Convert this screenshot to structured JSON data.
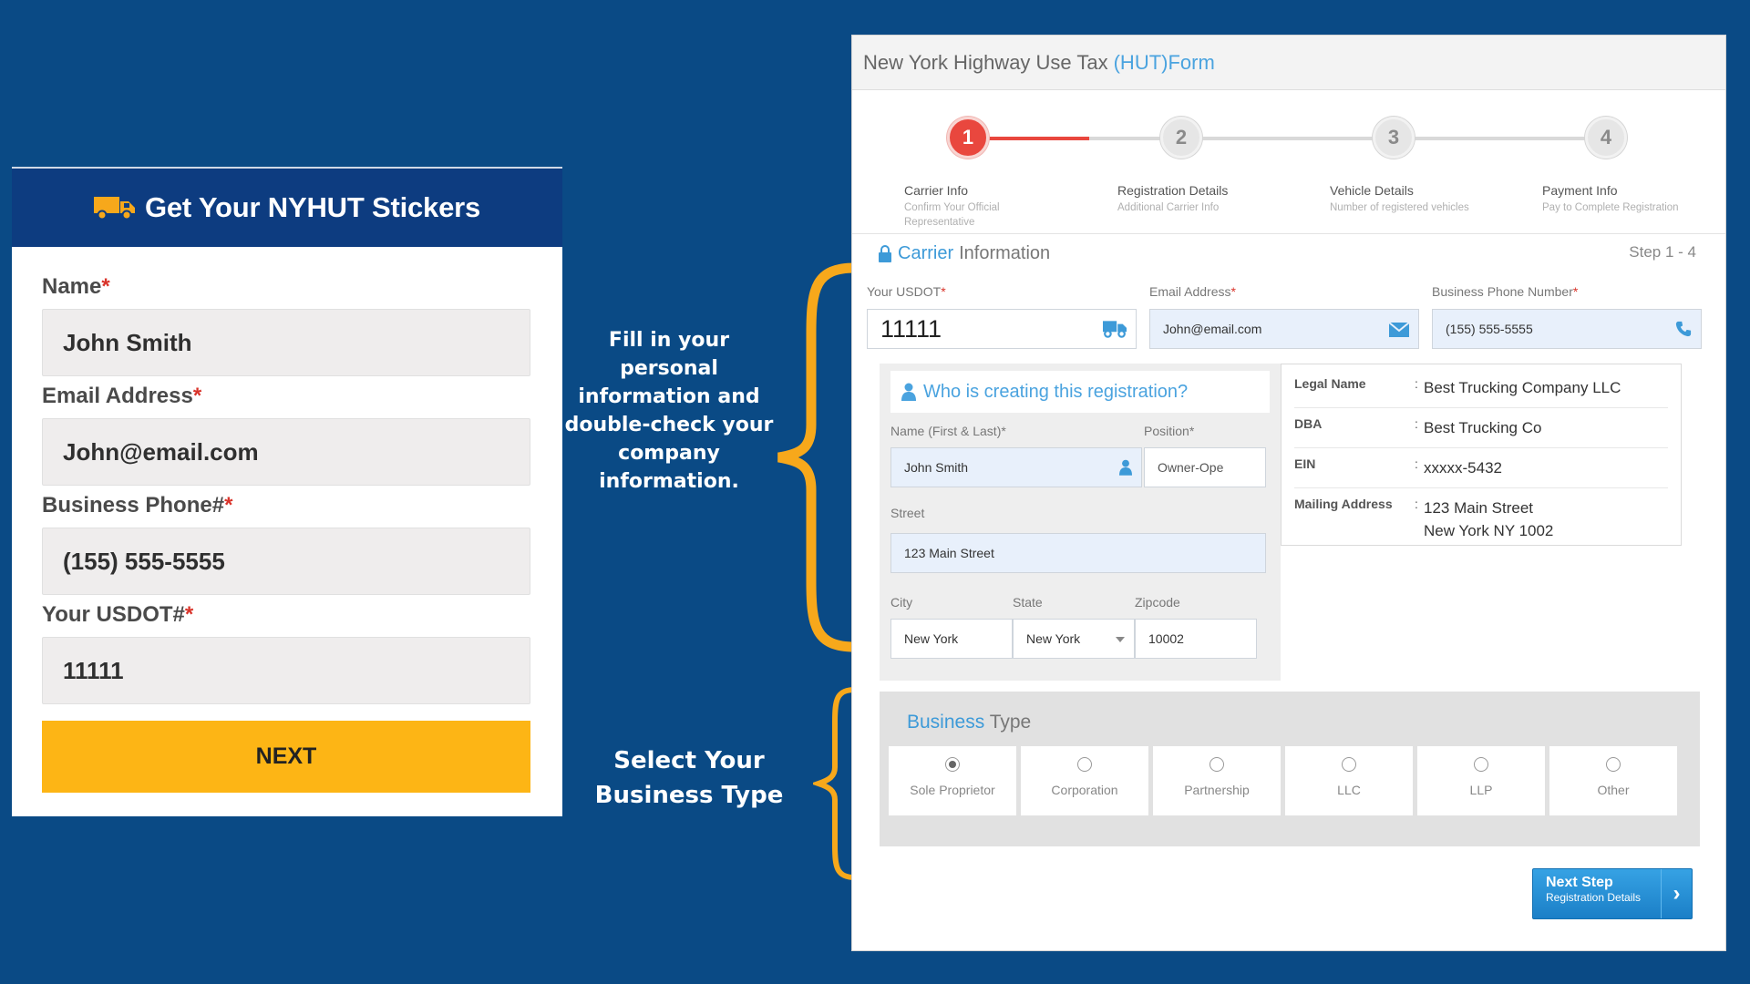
{
  "left_card": {
    "title": "Get Your NYHUT Stickers",
    "fields": [
      {
        "label": "Name",
        "value": "John Smith"
      },
      {
        "label": "Email Address",
        "value": "John@email.com"
      },
      {
        "label": "Business Phone#",
        "value": "(155) 555-5555"
      },
      {
        "label": "Your USDOT#",
        "value": "11111"
      }
    ],
    "required_mark": "*",
    "next_label": "NEXT"
  },
  "annotations": {
    "personal_info": "Fill in your personal information and double-check your company information.",
    "business_type": "Select Your Business Type"
  },
  "form": {
    "title_main": "New York Highway Use Tax",
    "title_highlight": "(HUT)Form",
    "steps": [
      {
        "number": "1",
        "name": "Carrier Info",
        "sub": "Confirm Your Official Representative"
      },
      {
        "number": "2",
        "name": "Registration Details",
        "sub": "Additional Carrier Info"
      },
      {
        "number": "3",
        "name": "Vehicle Details",
        "sub": "Number of registered vehicles"
      },
      {
        "number": "4",
        "name": "Payment Info",
        "sub": "Pay to Complete Registration"
      }
    ],
    "section_highlight": "Carrier",
    "section_rest": "Information",
    "step_count": "Step 1 - 4",
    "usdot": {
      "label": "Your USDOT",
      "value": "11111"
    },
    "email": {
      "label": "Email Address",
      "value": "John@email.com"
    },
    "phone": {
      "label": "Business Phone Number",
      "value": "(155) 555-5555"
    },
    "who": {
      "heading_highlight": "Who is creating this registration?",
      "name_label": "Name (First & Last)",
      "name_value": "John Smith",
      "position_label": "Position",
      "position_value": "Owner-Ope",
      "street_label": "Street",
      "street_value": "123 Main Street",
      "city_label": "City",
      "city_value": "New York",
      "state_label": "State",
      "state_value": "New York",
      "zip_label": "Zipcode",
      "zip_value": "10002"
    },
    "company": {
      "rows": [
        {
          "key": "Legal Name",
          "value": "Best Trucking Company LLC"
        },
        {
          "key": "DBA",
          "value": "Best Trucking Co"
        },
        {
          "key": "EIN",
          "value": "xxxxx-5432"
        },
        {
          "key": "Mailing Address",
          "value": "123 Main Street",
          "value2": "New York NY 1002"
        }
      ]
    },
    "business_type": {
      "heading_highlight": "Business",
      "heading_rest": "Type",
      "options": [
        "Sole Proprietor",
        "Corporation",
        "Partnership",
        "LLC",
        "LLP",
        "Other"
      ],
      "selected": "Sole Proprietor"
    },
    "next_step": {
      "line1": "Next Step",
      "line2": "Registration Details",
      "arrow": "›"
    }
  },
  "colors": {
    "background": "#0a4a85",
    "header_navy": "#0d3c80",
    "next_yellow": "#fdb515",
    "brace_orange": "#f7a81b",
    "active_step": "#e9473e",
    "link_blue": "#3d9ad8"
  },
  "icons": [
    "truck-icon",
    "lock-icon",
    "user-icon",
    "envelope-icon",
    "phone-icon",
    "chevron-down-icon",
    "chevron-right-icon"
  ]
}
